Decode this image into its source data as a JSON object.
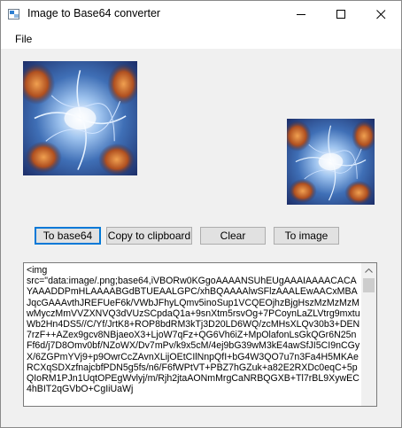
{
  "window": {
    "title": "Image to Base64 converter",
    "icon": "app-window-icon",
    "controls": [
      "minimize-icon",
      "maximize-icon",
      "close-icon"
    ]
  },
  "menu": {
    "items": [
      {
        "label": "File"
      }
    ]
  },
  "images": {
    "source": {
      "icon": "source-image-preview"
    },
    "result": {
      "icon": "decoded-image-preview"
    }
  },
  "buttons": {
    "to_base64": "To base64",
    "copy": "Copy to clipboard",
    "clear": "Clear",
    "to_image": "To image"
  },
  "output": {
    "text": "<img\nsrc=\"data:image/.png;base64,iVBORw0KGgoAAAANSUhEUgAAAIAAAACACAYAAADDPmHLAAAABGdBTUEAALGPC/xhBQAAAAlwSFlzAAALEwAACxMBAJqcGAAAvthJREFUeF6k/VWbJFhyLQmv5inoSup1VCQEOjhzBjgHszMzMzMzMwMyczMmVVZXNVQ3dVUzSCpdaQ1a+9snXtm5rsvOg+7PCoynLaZLVtrg9mxtuWb2Hn4DS5//C/Yf/JrtK8+ROP8bdRM3kTj3D20LD6WQ/zcMHsXLQv30b3+DEN7rzF++AZex9gcv8NBjaeoX3+LjoW7qFz+QG6Vh6iZ+MpOlafonLsGkQGr6N25nFf6d/j7D8Omv0bf/NZoWX/Dv7mPv/k9x5cM/4ej9bG39wM3kE4awSfJI5CI9nCGyX/6ZGPmYVj9+p9OwrCcZAvnXLijOEtCIlNnpQfI+bG4W3QO7u7n3Fa4H5MKAeRCXqSDXzfnajcbfPDN5g5fs/n6/F6fWPtVT+PBZ7hGZuk+a82E2RXDc0eqC+5pQIoRM1PJn1UqtOPEgWvlyj/m/Rjh2jtaAONmMrgCaNRBQGXB+Tl7rBL9XywEC4hBIT2qGVbO+CgIiUaWj"
  },
  "scrollbar": {
    "up_icon": "scroll-up-arrow-icon"
  }
}
